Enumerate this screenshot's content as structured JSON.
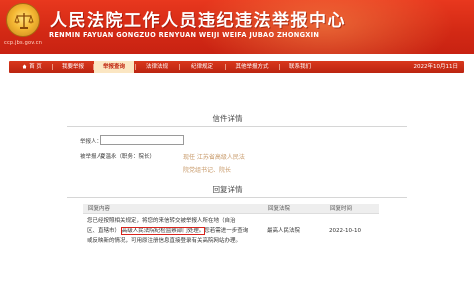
{
  "header": {
    "title": "人民法院工作人员违纪违法举报中心",
    "subtitle": "RENMIN FAYUAN GONGZUO RENYUAN WEIJI WEIFA JUBAO ZHONGXIN",
    "url": "ccp.jbs.gov.cn"
  },
  "nav": {
    "items": [
      {
        "label": "首 页"
      },
      {
        "label": "我要举报"
      },
      {
        "label": "举报查询"
      },
      {
        "label": "法律法规"
      },
      {
        "label": "纪律规定"
      },
      {
        "label": "其他举报方式"
      },
      {
        "label": "联系我们"
      }
    ],
    "active_index": 2,
    "date": "2022年10月11日"
  },
  "letter": {
    "section_title": "信件详情",
    "reporter_label": "举报人：",
    "reporter_value": "",
    "reported_label": "被举报人：",
    "reported_value": "夏温永（职务：院长）",
    "now_at_line1": "现任 江苏省高级人民法",
    "now_at_line2": "院党组书记、院长"
  },
  "reply": {
    "section_title": "回复详情",
    "columns": [
      "回复内容",
      "回复法院",
      "回复时间"
    ],
    "rows": [
      {
        "content_lines": [
          "您已经按照相关规定，将您的来信转交被举报人所在地（自治",
          "区、直辖市）",
          "高级人民法院纪检监察部门处理。",
          "您若需进一步查询",
          "或反映新的情况，可用原注册信息直接登录有关高院网站办理。"
        ],
        "court": "最高人民法院",
        "time": "2022-10-10"
      }
    ]
  },
  "colors": {
    "header_red": "#d42a15",
    "nav_active_bg": "#fbe6c2",
    "highlight_box": "#d8241c",
    "position_text": "#c89a6a"
  }
}
